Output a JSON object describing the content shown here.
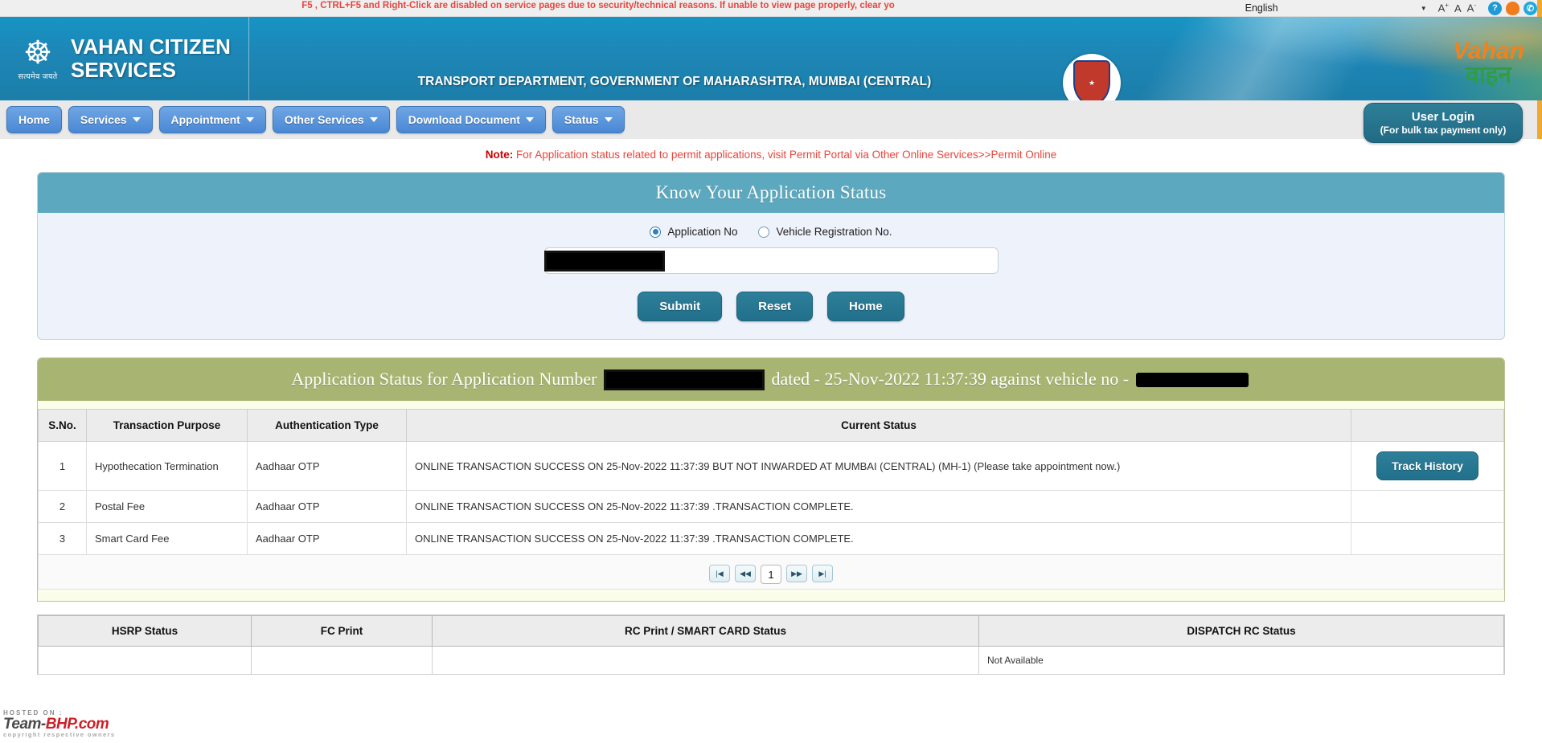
{
  "topbar": {
    "warning": "F5 , CTRL+F5 and Right-Click are disabled on service pages due to security/technical reasons. If unable to view page properly, clear yo",
    "language": "English",
    "font_increase": "A",
    "font_increase_sup": "+",
    "font_normal": "A",
    "font_decrease": "A",
    "font_decrease_sup": "-",
    "help_icon": "?",
    "icons": [
      "help-icon",
      "notification-icon",
      "call-icon"
    ]
  },
  "header": {
    "brand_line1": "VAHAN CITIZEN",
    "brand_line2": "SERVICES",
    "emblem_motto": "सत्यमेव जयते",
    "department": "TRANSPORT DEPARTMENT, GOVERNMENT OF MAHARASHTRA, MUMBAI (CENTRAL)",
    "logo_line1": "Vahan",
    "logo_line2": "वाहन"
  },
  "nav": {
    "items": [
      {
        "label": "Home",
        "has_caret": false
      },
      {
        "label": "Services",
        "has_caret": true
      },
      {
        "label": "Appointment",
        "has_caret": true
      },
      {
        "label": "Other Services",
        "has_caret": true
      },
      {
        "label": "Download Document",
        "has_caret": true
      },
      {
        "label": "Status",
        "has_caret": true
      }
    ],
    "login_line1": "User Login",
    "login_line2": "(For bulk tax payment only)"
  },
  "note": {
    "prefix": "Note:",
    "text": " For Application status related to permit applications, visit Permit Portal via Other Online Services>>Permit Online"
  },
  "search_panel": {
    "title": "Know Your Application Status",
    "radio_application_no": "Application No",
    "radio_vehicle_reg_no": "Vehicle Registration No.",
    "input_value": "",
    "input_placeholder": "",
    "submit_label": "Submit",
    "reset_label": "Reset",
    "home_label": "Home"
  },
  "result": {
    "banner_prefix": "Application Status for Application Number",
    "banner_middle": "dated - 25-Nov-2022 11:37:39 against vehicle no -",
    "columns": [
      "S.No.",
      "Transaction Purpose",
      "Authentication Type",
      "Current Status",
      ""
    ],
    "rows": [
      {
        "sno": "1",
        "purpose": "Hypothecation Termination",
        "auth": "Aadhaar OTP",
        "status": "ONLINE TRANSACTION SUCCESS ON 25-Nov-2022 11:37:39 BUT NOT INWARDED AT MUMBAI (CENTRAL) (MH-1) (Please take appointment now.)",
        "action": "Track History"
      },
      {
        "sno": "2",
        "purpose": "Postal Fee",
        "auth": "Aadhaar OTP",
        "status": "ONLINE TRANSACTION SUCCESS ON 25-Nov-2022 11:37:39 .TRANSACTION COMPLETE.",
        "action": ""
      },
      {
        "sno": "3",
        "purpose": "Smart Card Fee",
        "auth": "Aadhaar OTP",
        "status": "ONLINE TRANSACTION SUCCESS ON 25-Nov-2022 11:37:39 .TRANSACTION COMPLETE.",
        "action": ""
      }
    ],
    "pager": {
      "first": "|◀",
      "prev": "◀◀",
      "current": "1",
      "next": "▶▶",
      "last": "▶|"
    }
  },
  "bottom_table": {
    "columns": [
      "HSRP Status",
      "FC Print",
      "RC Print / SMART CARD Status",
      "DISPATCH RC Status"
    ],
    "rows": [
      {
        "hsrp": "",
        "fc": "",
        "rc": "",
        "dispatch": "Not Available"
      }
    ]
  },
  "watermark": {
    "hosted": "HOSTED ON :",
    "team": "Team-",
    "bhp": "BHP.com",
    "sub": "copyright respective owners"
  },
  "colors": {
    "header_blue": "#1d86b6",
    "nav_blue": "#4a88d4",
    "teal_button": "#22708b",
    "panel_head": "#5ca9bf",
    "result_head": "#a8b572",
    "warning_red": "#e8453c"
  }
}
